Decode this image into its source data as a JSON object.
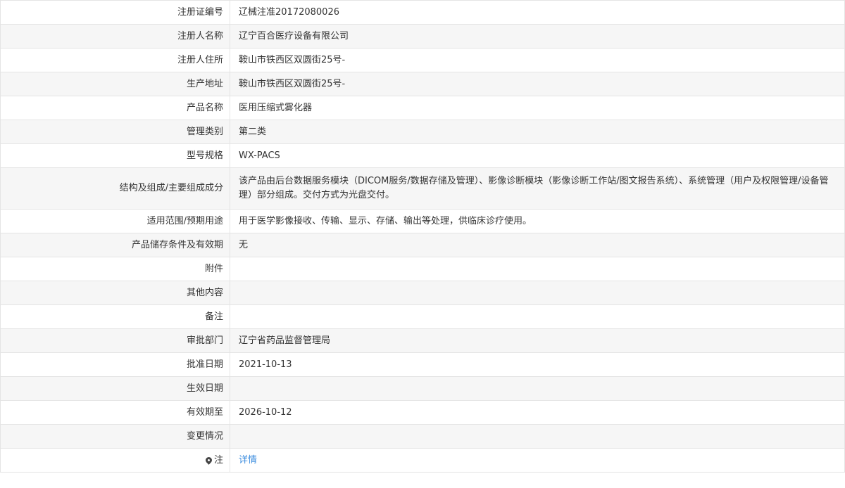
{
  "rows": [
    {
      "label": "注册证编号",
      "value": "辽械注准20172080026"
    },
    {
      "label": "注册人名称",
      "value": "辽宁百合医疗设备有限公司"
    },
    {
      "label": "注册人住所",
      "value": "鞍山市铁西区双圆街25号-"
    },
    {
      "label": "生产地址",
      "value": "鞍山市铁西区双圆街25号-"
    },
    {
      "label": "产品名称",
      "value": "医用压缩式雾化器"
    },
    {
      "label": "管理类别",
      "value": "第二类"
    },
    {
      "label": "型号规格",
      "value": "WX-PACS"
    },
    {
      "label": "结构及组成/主要组成成分",
      "value": "该产品由后台数据服务模块（DICOM服务/数据存储及管理）、影像诊断模块（影像诊断工作站/图文报告系统）、系统管理（用户及权限管理/设备管理）部分组成。交付方式为光盘交付。"
    },
    {
      "label": "适用范围/预期用途",
      "value": "用于医学影像接收、传输、显示、存储、输出等处理，供临床诊疗使用。"
    },
    {
      "label": "产品储存条件及有效期",
      "value": "无"
    },
    {
      "label": "附件",
      "value": ""
    },
    {
      "label": "其他内容",
      "value": ""
    },
    {
      "label": "备注",
      "value": ""
    },
    {
      "label": "审批部门",
      "value": "辽宁省药品监督管理局"
    },
    {
      "label": "批准日期",
      "value": "2021-10-13"
    },
    {
      "label": "生效日期",
      "value": ""
    },
    {
      "label": "有效期至",
      "value": "2026-10-12"
    },
    {
      "label": "变更情况",
      "value": ""
    }
  ],
  "note": {
    "icon": "pin-icon",
    "label": "注",
    "link_text": "详情"
  }
}
